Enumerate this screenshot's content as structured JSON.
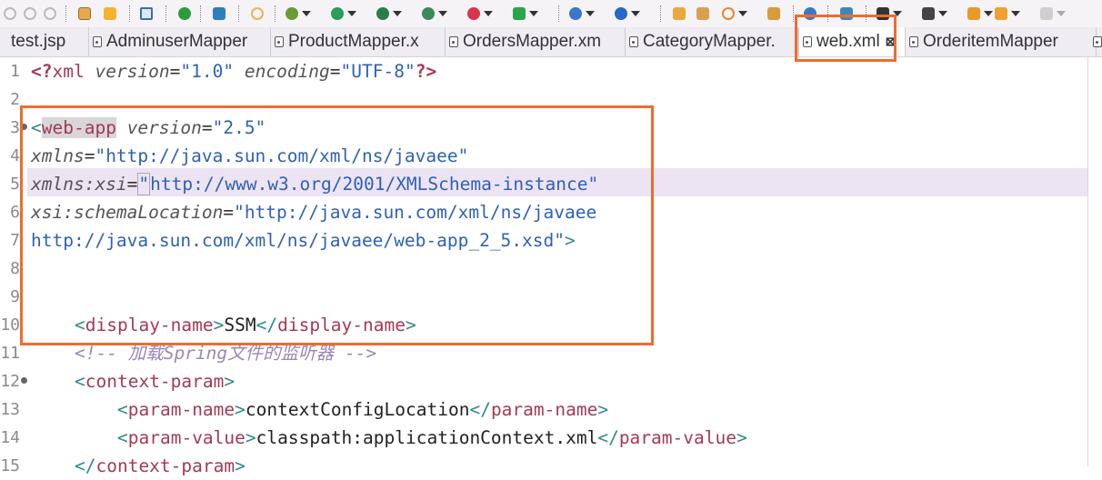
{
  "toolbar": {
    "icons": [
      "undo-icon",
      "redo-icon",
      "new-icon",
      "save-icon",
      "properties-icon",
      "clean-icon",
      "link-icon",
      "run-icon",
      "publish-icon",
      "server-icon",
      "debug-icon",
      "run-arrow-icon",
      "coverage-icon",
      "external-tools-icon",
      "stop-icon",
      "launch-icon",
      "web-icon",
      "spring-icon",
      "folder-icon",
      "new-file-icon",
      "search-icon",
      "open-type-icon",
      "world-icon",
      "tree-icon",
      "annotation-icon",
      "next-annotation-icon",
      "prev-annotation-icon",
      "back-icon",
      "forward-icon"
    ]
  },
  "tabs": [
    {
      "label": "test.jsp",
      "active": false
    },
    {
      "label": "AdminuserMapper",
      "active": false
    },
    {
      "label": "ProductMapper.x",
      "active": false
    },
    {
      "label": "OrdersMapper.xm",
      "active": false
    },
    {
      "label": "CategoryMapper.",
      "active": false
    },
    {
      "label": "web.xml",
      "active": true,
      "close": "⊠"
    },
    {
      "label": "OrderitemMapper",
      "active": false
    }
  ],
  "editor": {
    "line_numbers": [
      "1",
      "2",
      "3",
      "4",
      "5",
      "6",
      "7",
      "8",
      "9",
      "10",
      "11",
      "12",
      "13",
      "14",
      "15"
    ],
    "lines": {
      "l1": {
        "open": "<?",
        "name": "xml",
        "a1": "version",
        "v1": "\"1.0\"",
        "a2": "encoding",
        "v2": "\"UTF-8\"",
        "close": "?>"
      },
      "l3": {
        "open": "<",
        "name": "web-app",
        "attr": "version",
        "val": "\"2.5\""
      },
      "l4": {
        "attr": "xmlns",
        "val": "\"http://java.sun.com/xml/ns/javaee\""
      },
      "l5": {
        "attr": "xmlns:xsi",
        "q": "\"",
        "val": "http://www.w3.org/2001/XMLSchema-instance\""
      },
      "l6": {
        "attr": "xsi:schemaLocation",
        "val": "\"http://java.sun.com/xml/ns/javaee"
      },
      "l7": {
        "val": "http://java.sun.com/xml/ns/javaee/web-app_2_5.xsd\"",
        "close": ">"
      },
      "l10": {
        "o1": "<",
        "name": "display-name",
        "c1": ">",
        "text": "SSM",
        "o2": "</",
        "c2": ">"
      },
      "l11": {
        "comment": "<!-- 加载Spring文件的监听器 -->"
      },
      "l12": {
        "open": "<",
        "name": "context-param",
        "close": ">"
      },
      "l13": {
        "o1": "<",
        "name": "param-name",
        "c1": ">",
        "text": "contextConfigLocation",
        "o2": "</",
        "c2": ">"
      },
      "l14": {
        "o1": "<",
        "name": "param-value",
        "c1": ">",
        "text": "classpath:applicationContext.xml",
        "o2": "</",
        "c2": ">"
      },
      "l15": {
        "open": "</",
        "name": "context-param",
        "close": ">"
      }
    }
  },
  "colors": {
    "highlight_box": "#f26a2e",
    "current_line": "#ece3f3"
  }
}
